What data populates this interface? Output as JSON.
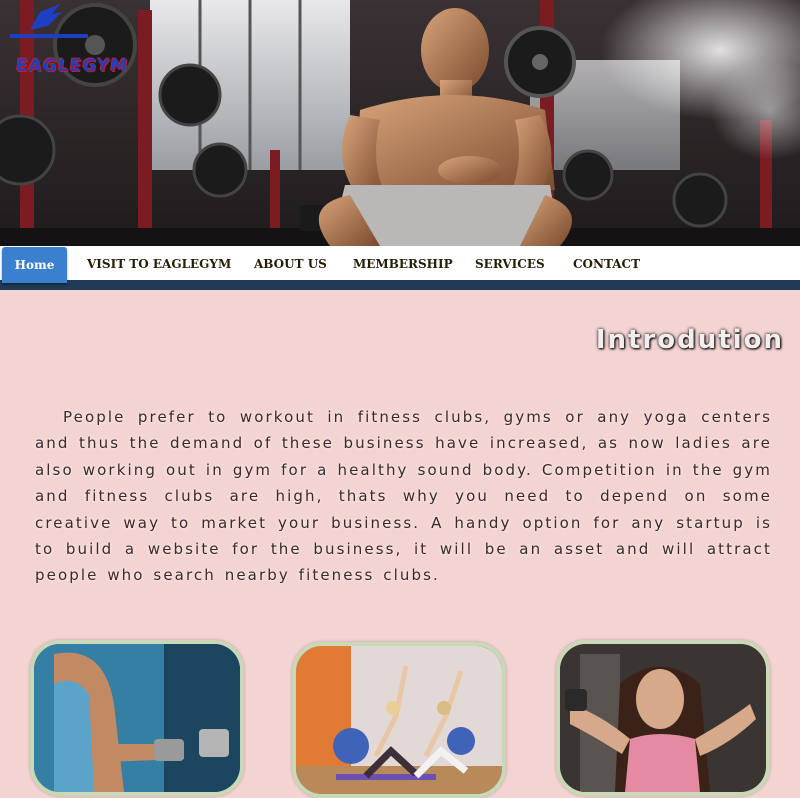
{
  "brand": {
    "logo_text": "EAGLEGYM"
  },
  "nav": {
    "items": [
      {
        "label": "Home",
        "active": true
      },
      {
        "label": "VISIT TO EAGLEGYM"
      },
      {
        "label": "ABOUT US"
      },
      {
        "label": "MEMBERSHIP"
      },
      {
        "label": "SERVICES"
      },
      {
        "label": "CONTACT"
      }
    ]
  },
  "intro": {
    "title": "Introdution",
    "body": "People prefer to workout in fitness clubs, gyms or any yoga centers and thus the demand of these business have increased, as now ladies are also working out in gym for a healthy sound body. Competition in the gym and fitness clubs are high, thats why you need to depend on some creative way to market your business. A handy option for any startup is to build a website for the business, it will be an asset and will attract people who search nearby fiteness clubs."
  },
  "colors": {
    "page_bg": "#f4d4d2",
    "nav_active": "#3b7fcf",
    "nav_bar": "#213a55",
    "photo_border": "#c9d8b6"
  }
}
